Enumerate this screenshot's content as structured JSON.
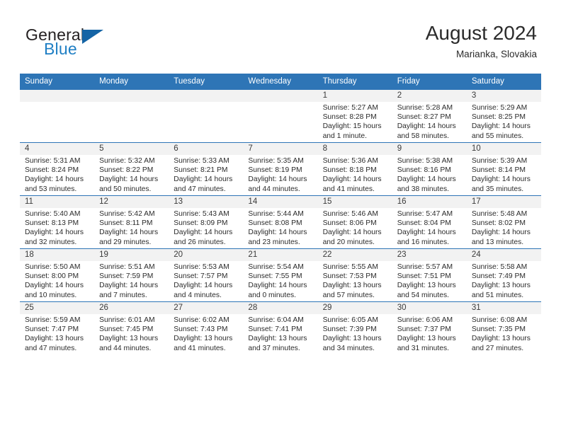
{
  "brand": {
    "name_top": "General",
    "name_bottom": "Blue",
    "logo_icon": "blue-triangle-flag",
    "accent_color": "#1f7fc4"
  },
  "header": {
    "month_title": "August 2024",
    "location": "Marianka, Slovakia"
  },
  "calendar": {
    "header_color": "#2e75b6",
    "daynum_band_color": "#f2f2f2",
    "weekdays": [
      "Sunday",
      "Monday",
      "Tuesday",
      "Wednesday",
      "Thursday",
      "Friday",
      "Saturday"
    ],
    "labels": {
      "sunrise_prefix": "Sunrise:",
      "sunset_prefix": "Sunset:",
      "daylight_prefix": "Daylight:"
    },
    "weeks": [
      [
        {
          "day": "",
          "sunrise": "",
          "sunset": "",
          "daylight": ""
        },
        {
          "day": "",
          "sunrise": "",
          "sunset": "",
          "daylight": ""
        },
        {
          "day": "",
          "sunrise": "",
          "sunset": "",
          "daylight": ""
        },
        {
          "day": "",
          "sunrise": "",
          "sunset": "",
          "daylight": ""
        },
        {
          "day": "1",
          "sunrise": "Sunrise: 5:27 AM",
          "sunset": "Sunset: 8:28 PM",
          "daylight": "Daylight: 15 hours and 1 minute."
        },
        {
          "day": "2",
          "sunrise": "Sunrise: 5:28 AM",
          "sunset": "Sunset: 8:27 PM",
          "daylight": "Daylight: 14 hours and 58 minutes."
        },
        {
          "day": "3",
          "sunrise": "Sunrise: 5:29 AM",
          "sunset": "Sunset: 8:25 PM",
          "daylight": "Daylight: 14 hours and 55 minutes."
        }
      ],
      [
        {
          "day": "4",
          "sunrise": "Sunrise: 5:31 AM",
          "sunset": "Sunset: 8:24 PM",
          "daylight": "Daylight: 14 hours and 53 minutes."
        },
        {
          "day": "5",
          "sunrise": "Sunrise: 5:32 AM",
          "sunset": "Sunset: 8:22 PM",
          "daylight": "Daylight: 14 hours and 50 minutes."
        },
        {
          "day": "6",
          "sunrise": "Sunrise: 5:33 AM",
          "sunset": "Sunset: 8:21 PM",
          "daylight": "Daylight: 14 hours and 47 minutes."
        },
        {
          "day": "7",
          "sunrise": "Sunrise: 5:35 AM",
          "sunset": "Sunset: 8:19 PM",
          "daylight": "Daylight: 14 hours and 44 minutes."
        },
        {
          "day": "8",
          "sunrise": "Sunrise: 5:36 AM",
          "sunset": "Sunset: 8:18 PM",
          "daylight": "Daylight: 14 hours and 41 minutes."
        },
        {
          "day": "9",
          "sunrise": "Sunrise: 5:38 AM",
          "sunset": "Sunset: 8:16 PM",
          "daylight": "Daylight: 14 hours and 38 minutes."
        },
        {
          "day": "10",
          "sunrise": "Sunrise: 5:39 AM",
          "sunset": "Sunset: 8:14 PM",
          "daylight": "Daylight: 14 hours and 35 minutes."
        }
      ],
      [
        {
          "day": "11",
          "sunrise": "Sunrise: 5:40 AM",
          "sunset": "Sunset: 8:13 PM",
          "daylight": "Daylight: 14 hours and 32 minutes."
        },
        {
          "day": "12",
          "sunrise": "Sunrise: 5:42 AM",
          "sunset": "Sunset: 8:11 PM",
          "daylight": "Daylight: 14 hours and 29 minutes."
        },
        {
          "day": "13",
          "sunrise": "Sunrise: 5:43 AM",
          "sunset": "Sunset: 8:09 PM",
          "daylight": "Daylight: 14 hours and 26 minutes."
        },
        {
          "day": "14",
          "sunrise": "Sunrise: 5:44 AM",
          "sunset": "Sunset: 8:08 PM",
          "daylight": "Daylight: 14 hours and 23 minutes."
        },
        {
          "day": "15",
          "sunrise": "Sunrise: 5:46 AM",
          "sunset": "Sunset: 8:06 PM",
          "daylight": "Daylight: 14 hours and 20 minutes."
        },
        {
          "day": "16",
          "sunrise": "Sunrise: 5:47 AM",
          "sunset": "Sunset: 8:04 PM",
          "daylight": "Daylight: 14 hours and 16 minutes."
        },
        {
          "day": "17",
          "sunrise": "Sunrise: 5:48 AM",
          "sunset": "Sunset: 8:02 PM",
          "daylight": "Daylight: 14 hours and 13 minutes."
        }
      ],
      [
        {
          "day": "18",
          "sunrise": "Sunrise: 5:50 AM",
          "sunset": "Sunset: 8:00 PM",
          "daylight": "Daylight: 14 hours and 10 minutes."
        },
        {
          "day": "19",
          "sunrise": "Sunrise: 5:51 AM",
          "sunset": "Sunset: 7:59 PM",
          "daylight": "Daylight: 14 hours and 7 minutes."
        },
        {
          "day": "20",
          "sunrise": "Sunrise: 5:53 AM",
          "sunset": "Sunset: 7:57 PM",
          "daylight": "Daylight: 14 hours and 4 minutes."
        },
        {
          "day": "21",
          "sunrise": "Sunrise: 5:54 AM",
          "sunset": "Sunset: 7:55 PM",
          "daylight": "Daylight: 14 hours and 0 minutes."
        },
        {
          "day": "22",
          "sunrise": "Sunrise: 5:55 AM",
          "sunset": "Sunset: 7:53 PM",
          "daylight": "Daylight: 13 hours and 57 minutes."
        },
        {
          "day": "23",
          "sunrise": "Sunrise: 5:57 AM",
          "sunset": "Sunset: 7:51 PM",
          "daylight": "Daylight: 13 hours and 54 minutes."
        },
        {
          "day": "24",
          "sunrise": "Sunrise: 5:58 AM",
          "sunset": "Sunset: 7:49 PM",
          "daylight": "Daylight: 13 hours and 51 minutes."
        }
      ],
      [
        {
          "day": "25",
          "sunrise": "Sunrise: 5:59 AM",
          "sunset": "Sunset: 7:47 PM",
          "daylight": "Daylight: 13 hours and 47 minutes."
        },
        {
          "day": "26",
          "sunrise": "Sunrise: 6:01 AM",
          "sunset": "Sunset: 7:45 PM",
          "daylight": "Daylight: 13 hours and 44 minutes."
        },
        {
          "day": "27",
          "sunrise": "Sunrise: 6:02 AM",
          "sunset": "Sunset: 7:43 PM",
          "daylight": "Daylight: 13 hours and 41 minutes."
        },
        {
          "day": "28",
          "sunrise": "Sunrise: 6:04 AM",
          "sunset": "Sunset: 7:41 PM",
          "daylight": "Daylight: 13 hours and 37 minutes."
        },
        {
          "day": "29",
          "sunrise": "Sunrise: 6:05 AM",
          "sunset": "Sunset: 7:39 PM",
          "daylight": "Daylight: 13 hours and 34 minutes."
        },
        {
          "day": "30",
          "sunrise": "Sunrise: 6:06 AM",
          "sunset": "Sunset: 7:37 PM",
          "daylight": "Daylight: 13 hours and 31 minutes."
        },
        {
          "day": "31",
          "sunrise": "Sunrise: 6:08 AM",
          "sunset": "Sunset: 7:35 PM",
          "daylight": "Daylight: 13 hours and 27 minutes."
        }
      ]
    ]
  }
}
